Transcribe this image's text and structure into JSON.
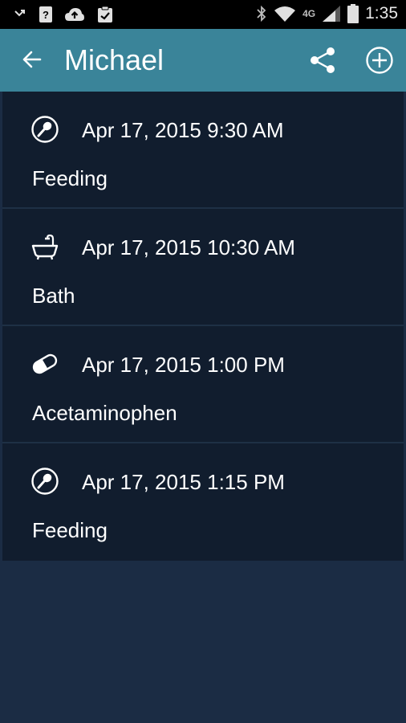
{
  "status_bar": {
    "network_tag": "4G",
    "time": "1:35",
    "icons": [
      "missed-call-icon",
      "unknown-file-icon",
      "cloud-upload-icon",
      "clipboard-check-icon",
      "bluetooth-icon",
      "wifi-icon",
      "signal-icon",
      "battery-icon"
    ]
  },
  "app_bar": {
    "title": "Michael",
    "back_icon": "arrow-left-icon",
    "share_icon": "share-icon",
    "add_icon": "plus-circle-icon"
  },
  "entries": [
    {
      "icon": "feeding-icon",
      "time": "Apr 17, 2015 9:30 AM",
      "label": "Feeding"
    },
    {
      "icon": "bathtub-icon",
      "time": "Apr 17, 2015 10:30 AM",
      "label": "Bath"
    },
    {
      "icon": "pill-icon",
      "time": "Apr 17, 2015 1:00 PM",
      "label": "Acetaminophen"
    },
    {
      "icon": "feeding-icon",
      "time": "Apr 17, 2015 1:15 PM",
      "label": "Feeding"
    }
  ],
  "colors": {
    "status_bar": "#000000",
    "app_bar": "#3a8499",
    "list_item": "#111d2e",
    "background": "#1b2c44",
    "text": "#ffffff"
  }
}
